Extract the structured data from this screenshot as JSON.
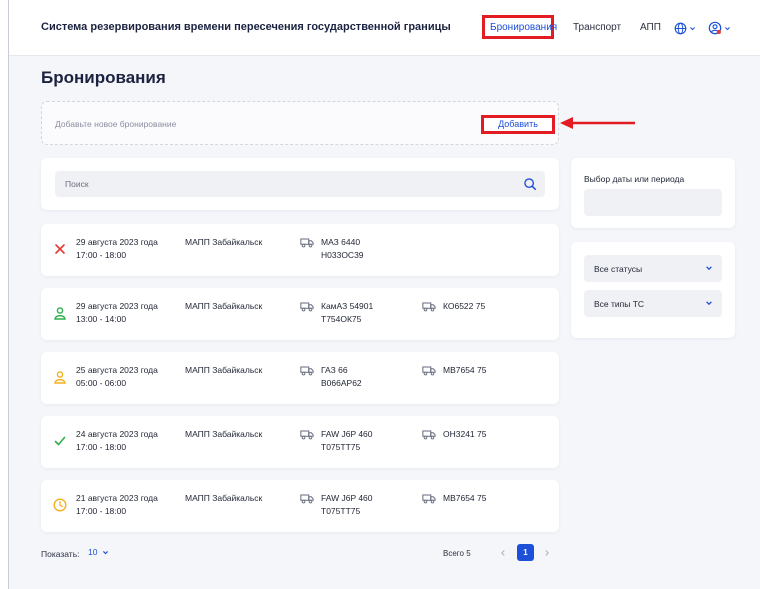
{
  "header": {
    "app_title": "Система резервирования времени пересечения государственной границы",
    "nav": [
      {
        "label": "Бронирования",
        "active": true
      },
      {
        "label": "Транспорт",
        "active": false
      },
      {
        "label": "АПП",
        "active": false
      }
    ],
    "icons": [
      "globe-icon",
      "user-icon"
    ]
  },
  "page": {
    "title": "Бронирования",
    "add_hint": "Добавьте новое бронирование",
    "add_button": "Добавить"
  },
  "search": {
    "placeholder": "Поиск",
    "icon": "search-icon"
  },
  "bookings": [
    {
      "status": "cancelled",
      "date": "29 августа 2023 года",
      "time": "17:00 - 18:00",
      "checkpoint": "МАПП Забайкальск",
      "vehicle_model": "МАЗ 6440",
      "vehicle_plate": "Н033ОС39",
      "trailer": ""
    },
    {
      "status": "driver-green",
      "date": "29 августа 2023 года",
      "time": "13:00 - 14:00",
      "checkpoint": "МАПП Забайкальск",
      "vehicle_model": "КамАЗ 54901",
      "vehicle_plate": "Т754ОК75",
      "trailer": "КО6522 75"
    },
    {
      "status": "driver-yellow",
      "date": "25 августа 2023 года",
      "time": "05:00 - 06:00",
      "checkpoint": "МАПП Забайкальск",
      "vehicle_model": "ГАЗ 66",
      "vehicle_plate": "В066АР62",
      "trailer": "МВ7654 75"
    },
    {
      "status": "done",
      "date": "24 августа 2023 года",
      "time": "17:00 - 18:00",
      "checkpoint": "МАПП Забайкальск",
      "vehicle_model": "FAW J6P 460",
      "vehicle_plate": "Т075ТТ75",
      "trailer": "ОН3241 75"
    },
    {
      "status": "pending",
      "date": "21 августа 2023 года",
      "time": "17:00 - 18:00",
      "checkpoint": "МАПП Забайкальск",
      "vehicle_model": "FAW J6P 460",
      "vehicle_plate": "Т075ТТ75",
      "trailer": "МВ7654 75"
    }
  ],
  "sidebar": {
    "date_label": "Выбор даты или периода",
    "status_select": "Все статусы",
    "vehicle_type_select": "Все типы ТС"
  },
  "pagination": {
    "show_label": "Показать:",
    "page_size": "10",
    "total_label": "Всего 5",
    "current_page": "1"
  },
  "colors": {
    "accent": "#1d4fd8",
    "highlight": "#e31b23",
    "cancelled": "#e53935",
    "success": "#2eae4f",
    "warning": "#f2b01e"
  }
}
